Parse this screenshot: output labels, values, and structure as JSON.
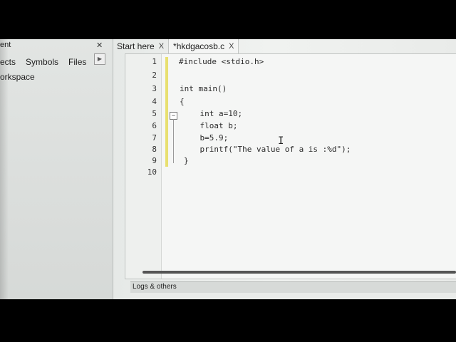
{
  "management": {
    "title": "ent",
    "tabs": [
      "ects",
      "Symbols",
      "Files"
    ],
    "close_glyph": "✕",
    "scroll_glyph": "▶",
    "workspace": "orkspace"
  },
  "editor_tabs": [
    {
      "label": "Start here",
      "close": "X"
    },
    {
      "label": "*hkdgacosb.c",
      "close": "X"
    }
  ],
  "editor": {
    "line_numbers": [
      "1",
      "2",
      "3",
      "4",
      "5",
      "6",
      "7",
      "8",
      "9",
      "10"
    ],
    "lines": [
      "#include <stdio.h>",
      "",
      "int main()",
      "{",
      "    int a=10;",
      "    float b;",
      "    b=5.9;",
      "    printf(\"The value of a is :%d\");",
      "}",
      ""
    ],
    "fold_glyph": "−",
    "cursor_glyph": "I"
  },
  "logs": {
    "label": "Logs & others"
  }
}
